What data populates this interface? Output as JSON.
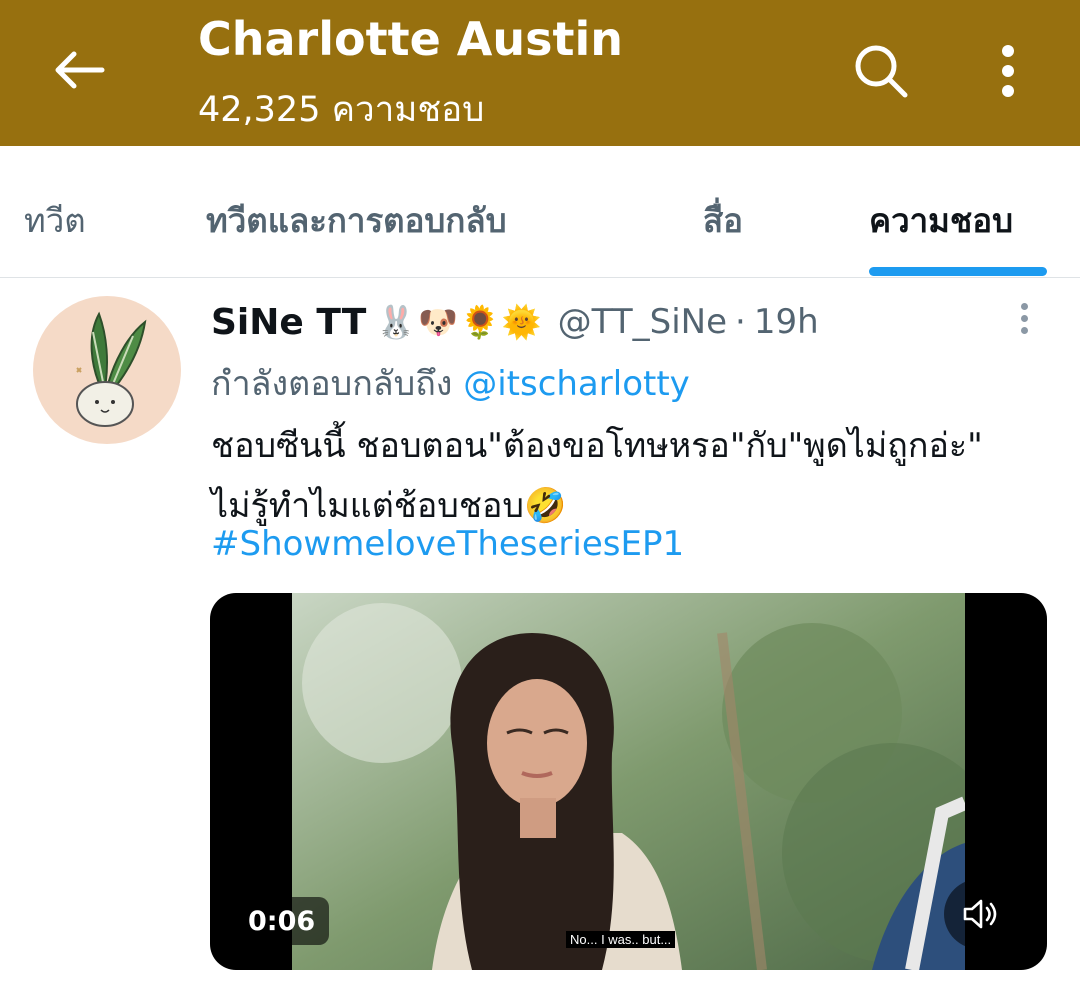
{
  "header": {
    "title": "Charlotte Austin",
    "subtitle": "42,325 ความชอบ",
    "background": "#97700f"
  },
  "tabs": [
    {
      "label": "ทวีต",
      "active": false
    },
    {
      "label": "ทวีตและการตอบกลับ",
      "active": false
    },
    {
      "label": "สื่อ",
      "active": false
    },
    {
      "label": "ความชอบ",
      "active": true
    }
  ],
  "accent_color": "#1d9bf0",
  "tweet": {
    "display_name": "SiNe TT",
    "emojis": "🐰🐶🌻🌞",
    "handle": "@TT_SiNe",
    "separator": "·",
    "time": "19h",
    "reply_prefix": "กำลังตอบกลับถึง",
    "reply_to": "@itscharlotty",
    "text": "ชอบซีนนี้ ชอบตอน\"ต้องขอโทษหรอ\"กับ\"พูดไม่ถูกอ่ะ\" ไม่รู้ทำไมแต่ช้อบชอบ🤣",
    "hashtag": "#ShowmeloveTheseriesEP1",
    "video": {
      "duration": "0:06",
      "caption": "No... I was.. but..."
    }
  },
  "icons": {
    "back": "arrow-left-icon",
    "search": "search-icon",
    "more": "more-vertical-icon",
    "caret": "more-vertical-icon",
    "mute": "speaker-muted-icon"
  }
}
